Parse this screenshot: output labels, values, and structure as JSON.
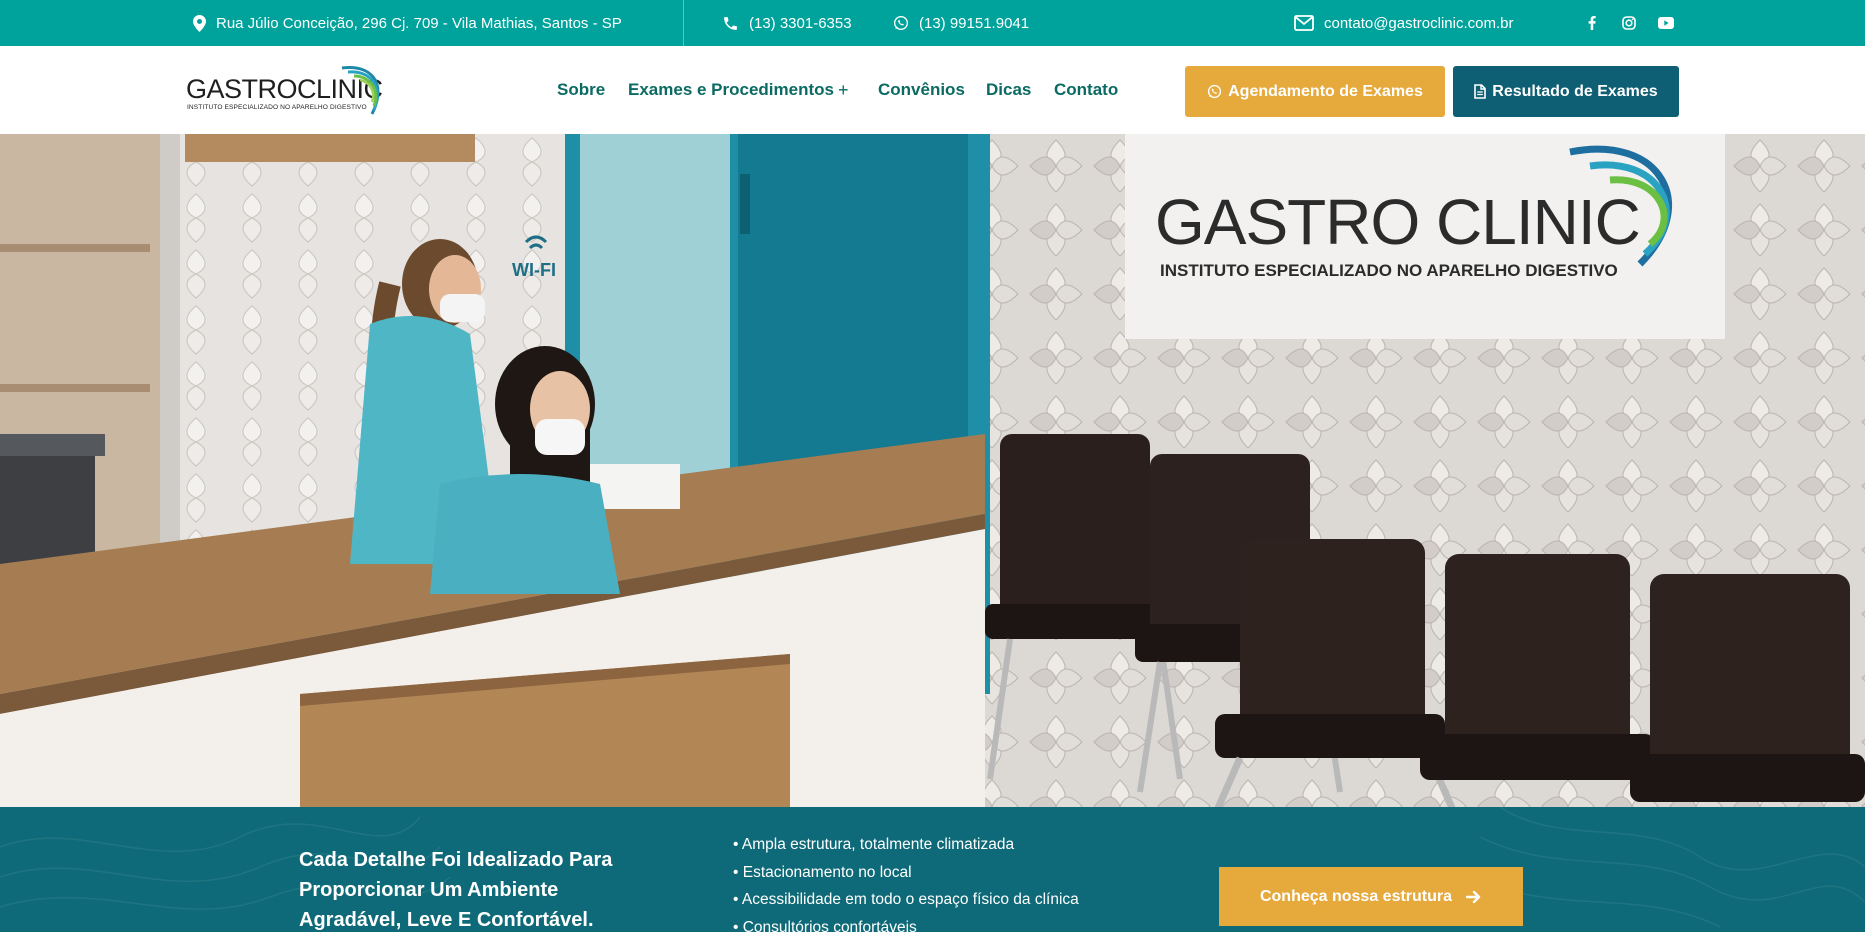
{
  "topbar": {
    "address": "Rua Júlio Conceição, 296 Cj. 709 - Vila Mathias, Santos - SP",
    "phone": "(13) 3301-6353",
    "whatsapp": "(13) 99151.9041",
    "email": "contato@gastroclinic.com.br",
    "socials": [
      "facebook-icon",
      "instagram-icon",
      "youtube-icon"
    ],
    "bg_color": "#00a39b"
  },
  "header": {
    "logo": {
      "word_part1": "GASTRO",
      "word_part2": "CLINIC",
      "tagline": "INSTITUTO ESPECIALIZADO NO APARELHO DIGESTIVO"
    },
    "nav": {
      "sobre": "Sobre",
      "exames": "Exames e Procedimentos",
      "exames_plus": "+",
      "convenios": "Convênios",
      "dicas": "Dicas",
      "contato": "Contato"
    },
    "buttons": {
      "agendamento": "Agendamento de Exames",
      "resultado": "Resultado de Exames"
    },
    "colors": {
      "nav": "#0b6b63",
      "yellow": "#e6aa3c",
      "blue": "#0f5f74"
    }
  },
  "hero": {
    "sign_title": "GASTRO CLINIC",
    "sign_subtitle": "INSTITUTO ESPECIALIZADO NO APARELHO DIGESTIVO",
    "wifi_label": "WI-FI"
  },
  "band": {
    "headline": "Cada Detalhe Foi Idealizado Para Proporcionar Um Ambiente Agradável, Leve E Confortável.",
    "features": [
      "• Ampla estrutura, totalmente climatizada",
      "• Estacionamento no local",
      "• Acessibilidade em todo o espaço físico da clínica",
      "• Consultórios confortáveis"
    ],
    "cta": "Conheça nossa estrutura",
    "bg_color": "#0e6a78"
  }
}
